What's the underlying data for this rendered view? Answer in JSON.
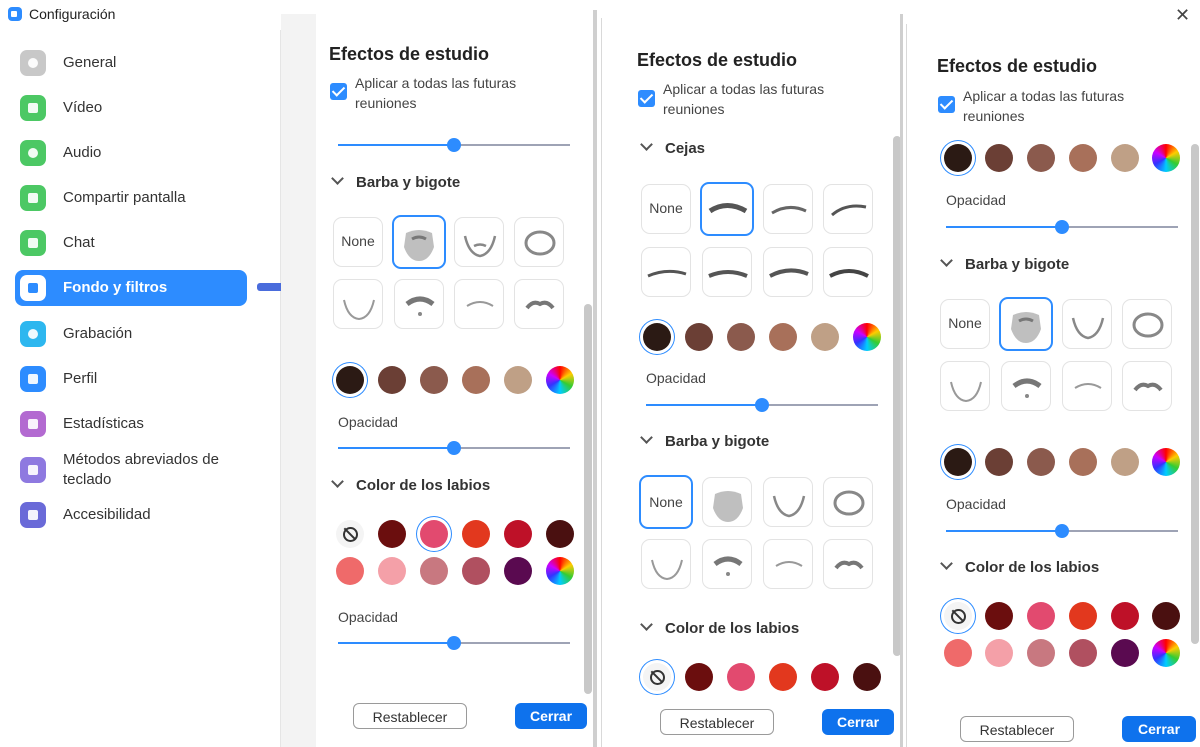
{
  "window": {
    "title": "Configuración",
    "close_glyph": "✕"
  },
  "sidebar": {
    "items": [
      {
        "label": "General",
        "icon": "gear-icon",
        "color": "#c8c8c8"
      },
      {
        "label": "Vídeo",
        "icon": "camera-icon",
        "color": "#4cc864"
      },
      {
        "label": "Audio",
        "icon": "headphones-icon",
        "color": "#4cc864"
      },
      {
        "label": "Compartir pantalla",
        "icon": "share-screen-icon",
        "color": "#4cc864"
      },
      {
        "label": "Chat",
        "icon": "chat-icon",
        "color": "#4cc864"
      },
      {
        "label": "Fondo y filtros",
        "icon": "background-icon",
        "color": "#ffffff",
        "active": true
      },
      {
        "label": "Grabación",
        "icon": "record-icon",
        "color": "#2db7ef"
      },
      {
        "label": "Perfil",
        "icon": "profile-icon",
        "color": "#2d8cff"
      },
      {
        "label": "Estadísticas",
        "icon": "statistics-icon",
        "color": "#b36ad1"
      },
      {
        "label": "Métodos abreviados de teclado",
        "icon": "keyboard-icon",
        "color": "#8e79e0"
      },
      {
        "label": "Accesibilidad",
        "icon": "accessibility-icon",
        "color": "#6a6ad8"
      }
    ]
  },
  "panel": {
    "title": "Efectos de estudio",
    "apply_label": "Aplicar a todas las futuras reuniones",
    "section_eyebrows": "Cejas",
    "section_beard": "Barba y bigote",
    "section_lips": "Color de los labios",
    "opacity_label": "Opacidad",
    "none_label": "None",
    "reset_label": "Restablecer",
    "close_label": "Cerrar"
  },
  "colors": {
    "accent": "#2d8cff",
    "hair_swatches": [
      "#2b1a14",
      "#6b3f35",
      "#8b5a4d",
      "#a8705a",
      "#bfa086",
      "rainbow"
    ],
    "lip_row1": [
      "none",
      "#6b0e0e",
      "#e24a6f",
      "#e2381e",
      "#be1128",
      "#4a1010"
    ],
    "lip_row2": [
      "#ef6a6a",
      "#f4a0a8",
      "#c87880",
      "#b05060",
      "#5a0a50",
      "rainbow"
    ]
  },
  "sliders": {
    "p1_top": 0.5,
    "p1_hair": 0.5,
    "p1_lips": 0.5,
    "p2_eyebrows": 0.5,
    "p3_top": 0.5,
    "p3_beard": 0.5
  }
}
